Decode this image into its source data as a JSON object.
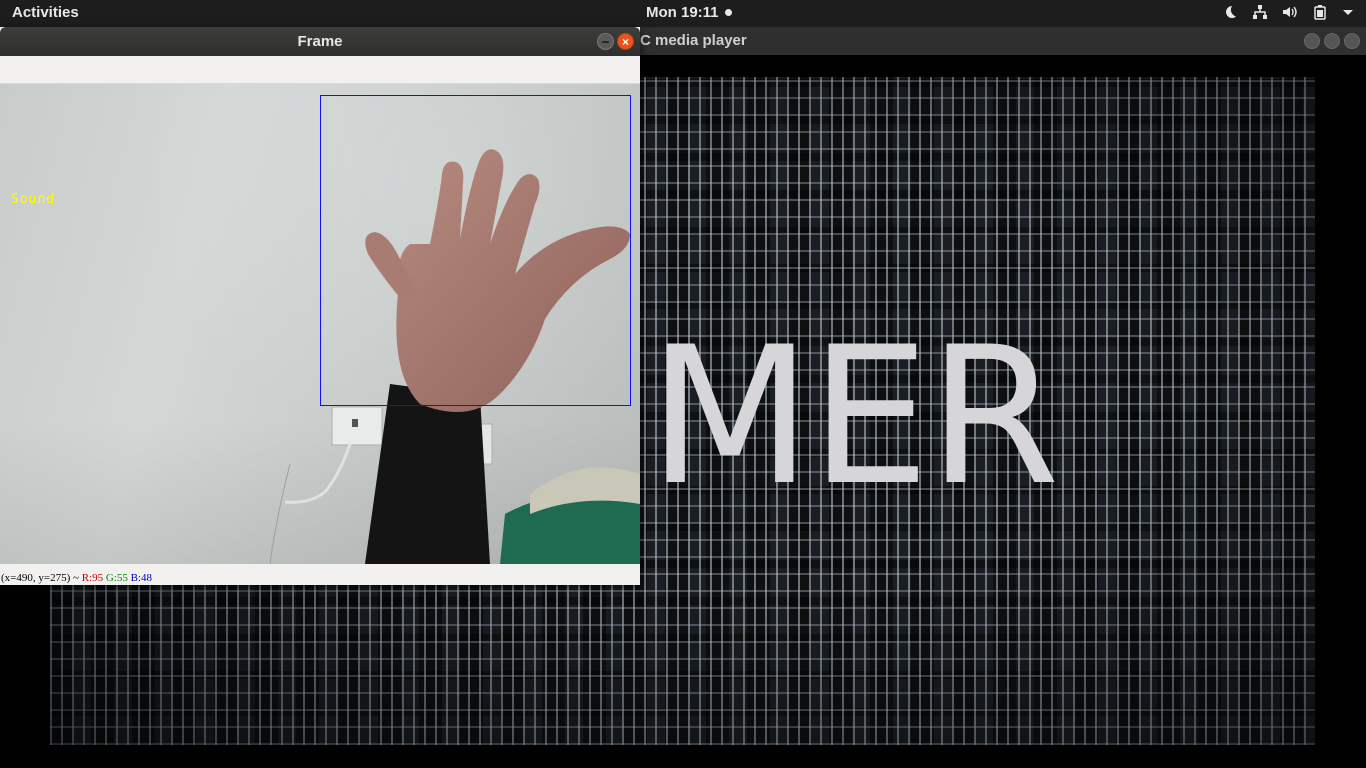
{
  "topbar": {
    "activities_label": "Activities",
    "clock": "Mon 19:11",
    "tray_icons": [
      "night-light-icon",
      "network-icon",
      "volume-icon",
      "battery-icon",
      "system-menu-arrow-icon"
    ]
  },
  "vlc": {
    "title": "C media player",
    "movie_text": "MER"
  },
  "frame": {
    "title": "Frame",
    "overlay_label": "Sound",
    "status": {
      "coords": "(x=490, y=275) ~",
      "r": "R:95",
      "g": "G:55",
      "b": "B:48"
    }
  },
  "colors": {
    "roi_box": "#1010ff",
    "overlay_label": "#ffff00",
    "close_button": "#e9541e"
  }
}
